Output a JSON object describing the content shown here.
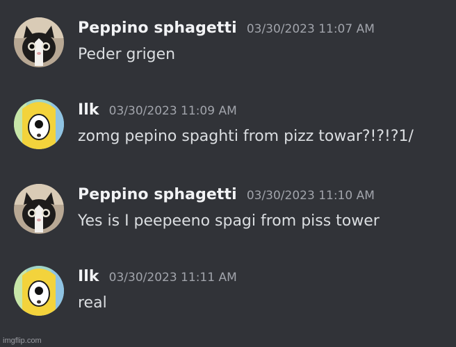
{
  "messages": [
    {
      "username": "Peppino sphagetti",
      "timestamp": "03/30/2023 11:07 AM",
      "content": "Peder grigen",
      "avatar": "cat-avatar-icon"
    },
    {
      "username": "Ilk",
      "timestamp": "03/30/2023 11:09 AM",
      "content": "zomg pepino spaghti from pizz towar?!?!?1/",
      "avatar": "yellow-creature-avatar-icon"
    },
    {
      "username": "Peppino sphagetti",
      "timestamp": "03/30/2023 11:10 AM",
      "content": "Yes is I peepeeno spagi from piss tower",
      "avatar": "cat-avatar-icon"
    },
    {
      "username": "Ilk",
      "timestamp": "03/30/2023 11:11 AM",
      "content": "real",
      "avatar": "yellow-creature-avatar-icon"
    }
  ],
  "watermark": "imgflip.com",
  "colors": {
    "background": "#313338",
    "username": "#f2f3f5",
    "timestamp": "#a1a4ab",
    "message_text": "#dbdee1"
  }
}
